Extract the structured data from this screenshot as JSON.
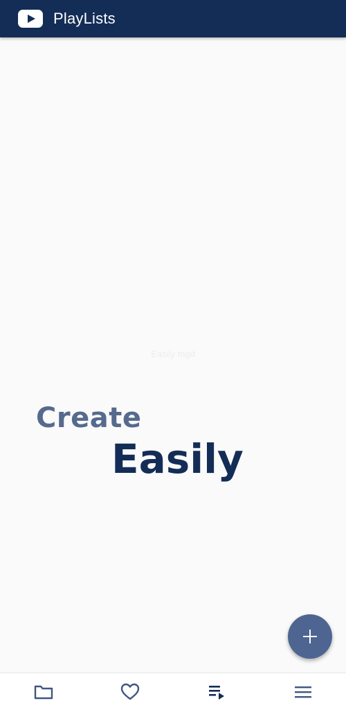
{
  "app": {
    "title": "PlayLists",
    "brand_color": "#142d57",
    "accent_color": "#4f6591"
  },
  "hero": {
    "faint_text": "Easily mgd",
    "line1": "Create",
    "line2": "Easily"
  },
  "fab": {
    "icon": "plus-icon"
  },
  "bottom_nav": {
    "items": [
      {
        "icon": "folder-icon"
      },
      {
        "icon": "heart-icon"
      },
      {
        "icon": "playlist-play-icon"
      },
      {
        "icon": "menu-icon"
      }
    ]
  }
}
